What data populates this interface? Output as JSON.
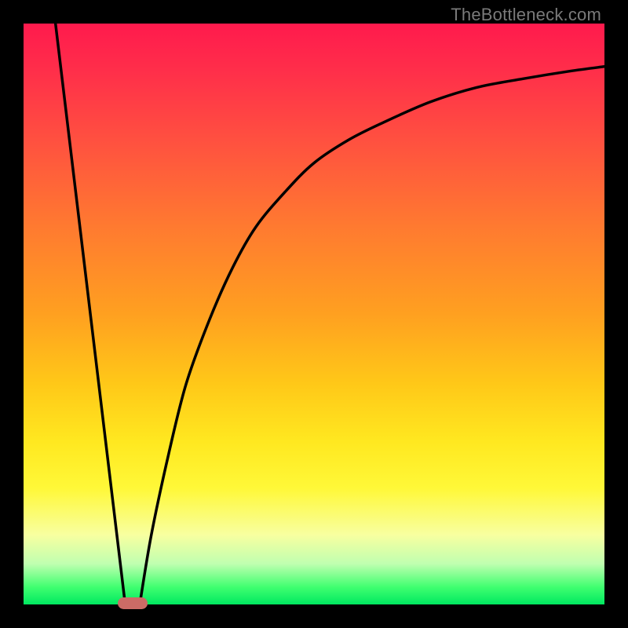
{
  "attribution": "TheBottleneck.com",
  "chart_data": {
    "type": "line",
    "title": "",
    "xlabel": "",
    "ylabel": "",
    "xlim": [
      0,
      100
    ],
    "ylim": [
      0,
      100
    ],
    "grid": false,
    "legend": false,
    "background_gradient": {
      "direction": "vertical",
      "stops": [
        {
          "pos": 0,
          "color": "#ff1a4d"
        },
        {
          "pos": 50,
          "color": "#ffa020"
        },
        {
          "pos": 80,
          "color": "#fff838"
        },
        {
          "pos": 100,
          "color": "#00e860"
        }
      ]
    },
    "series": [
      {
        "name": "left-branch",
        "stroke": "#000000",
        "x": [
          5.5,
          17.5
        ],
        "y": [
          100,
          0
        ]
      },
      {
        "name": "right-branch",
        "stroke": "#000000",
        "x": [
          20,
          22,
          25,
          28,
          32,
          36,
          40,
          45,
          50,
          56,
          62,
          70,
          78,
          86,
          94,
          100
        ],
        "y": [
          0,
          12,
          26,
          38,
          49,
          58,
          65,
          71,
          76,
          80,
          83,
          86.5,
          89,
          90.5,
          91.8,
          92.6
        ]
      }
    ],
    "marker": {
      "x_center": 18.8,
      "width_pct": 5.2,
      "y": 0,
      "color": "#cc6b66"
    }
  },
  "colors": {
    "frame": "#000000",
    "curve": "#000000",
    "marker": "#cc6b66"
  }
}
